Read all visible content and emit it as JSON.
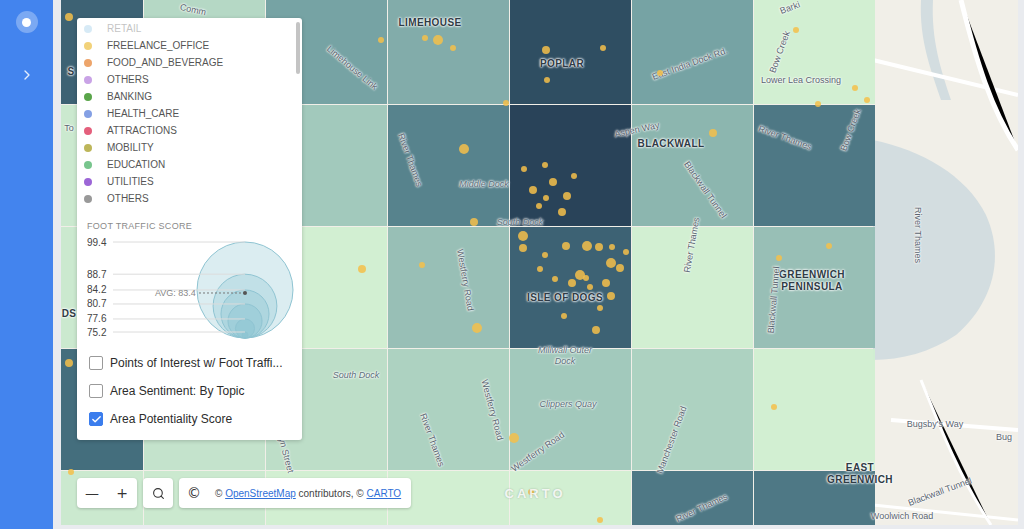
{
  "legend": {
    "categories": [
      {
        "name": "RETAIL",
        "color": "#8ec6e6",
        "faded": true
      },
      {
        "name": "FREELANCE_OFFICE",
        "color": "#f2d27a",
        "faded": false
      },
      {
        "name": "FOOD_AND_BEVERAGE",
        "color": "#eda56b",
        "faded": false
      },
      {
        "name": "OTHERS",
        "color": "#c9a3e6",
        "faded": false
      },
      {
        "name": "BANKING",
        "color": "#5aa54a",
        "faded": false
      },
      {
        "name": "HEALTH_CARE",
        "color": "#84a0e4",
        "faded": false
      },
      {
        "name": "ATTRACTIONS",
        "color": "#e45f7c",
        "faded": false
      },
      {
        "name": "MOBILITY",
        "color": "#bdb65a",
        "faded": false
      },
      {
        "name": "EDUCATION",
        "color": "#78c58d",
        "faded": false
      },
      {
        "name": "UTILITIES",
        "color": "#9c66d6",
        "faded": false
      },
      {
        "name": "OTHERS",
        "color": "#999999",
        "faded": false
      }
    ],
    "foot_traffic": {
      "title": "FOOT TRAFFIC SCORE",
      "ticks": [
        "99.4",
        "88.7",
        "84.2",
        "80.7",
        "77.6",
        "75.2"
      ],
      "avg": "AVG: 83.4"
    },
    "layers": [
      {
        "label": "Points of Interest w/ Foot Traffi...",
        "checked": false
      },
      {
        "label": "Area Sentiment: By Topic",
        "checked": false
      },
      {
        "label": "Area Potentiality Score",
        "checked": true
      }
    ]
  },
  "potentiality_grid": [
    [
      0.85,
      0.25,
      0.55,
      0.5,
      0.95,
      0.55,
      0.05
    ],
    [
      0.1,
      0.15,
      0.35,
      0.7,
      1.0,
      0.45,
      0.75
    ],
    [
      0.1,
      0.15,
      0.05,
      0.4,
      0.85,
      0.05,
      0.4
    ],
    [
      0.8,
      0.15,
      0.2,
      0.3,
      0.35,
      0.3,
      0.05
    ],
    [
      0.1,
      0.1,
      0.05,
      0.05,
      0.05,
      0.75,
      0.75
    ]
  ],
  "map_labels": [
    {
      "text": "LIMEHOUSE",
      "kind": "district"
    },
    {
      "text": "POPLAR",
      "kind": "district"
    },
    {
      "text": "BLACKWALL",
      "kind": "district"
    },
    {
      "text": "ISLE OF DOGS",
      "kind": "district"
    },
    {
      "text": "GREENWICH PENINSULA",
      "kind": "district"
    },
    {
      "text": "EAST GREENWICH",
      "kind": "district"
    },
    {
      "text": "Limehouse Link",
      "kind": "road"
    },
    {
      "text": "East India Dock Rd.",
      "kind": "road"
    },
    {
      "text": "Lower Lea Crossing",
      "kind": "road"
    },
    {
      "text": "Bow Creek",
      "kind": "road"
    },
    {
      "text": "Bow Creek",
      "kind": "road"
    },
    {
      "text": "Barki",
      "kind": "road"
    },
    {
      "text": "Comm",
      "kind": "road"
    },
    {
      "text": "Aspen Way",
      "kind": "road"
    },
    {
      "text": "Middle Dock",
      "kind": "water"
    },
    {
      "text": "South Dock",
      "kind": "water"
    },
    {
      "text": "River Thames",
      "kind": "road"
    },
    {
      "text": "Westferry Road",
      "kind": "road"
    },
    {
      "text": "Millwall Outer Dock",
      "kind": "water"
    },
    {
      "text": "South Dock",
      "kind": "water"
    },
    {
      "text": "Clippers Quay",
      "kind": "water"
    },
    {
      "text": "River Thames",
      "kind": "road"
    },
    {
      "text": "Westferry Road",
      "kind": "road"
    },
    {
      "text": "Westferry Road",
      "kind": "road"
    },
    {
      "text": "Manchester Road",
      "kind": "road"
    },
    {
      "text": "River Thames",
      "kind": "road"
    },
    {
      "text": "Blackwall Tunnel",
      "kind": "road"
    },
    {
      "text": "River Thames",
      "kind": "road"
    },
    {
      "text": "Blackwall Tunnel",
      "kind": "road"
    },
    {
      "text": "River Thames",
      "kind": "road"
    },
    {
      "text": "Bugsby's Way",
      "kind": "road"
    },
    {
      "text": "Bug",
      "kind": "road"
    },
    {
      "text": "Blackwall Tunnel",
      "kind": "road"
    },
    {
      "text": "Woolwich Road",
      "kind": "road"
    },
    {
      "text": "River Thames",
      "kind": "road"
    },
    {
      "text": "elyn Street",
      "kind": "road"
    },
    {
      "text": "DS",
      "kind": "district"
    },
    {
      "text": "S",
      "kind": "district"
    },
    {
      "text": "To",
      "kind": "road"
    }
  ],
  "zoom": {
    "out": "—",
    "in": "+"
  },
  "attribution": {
    "button": "©",
    "parts": [
      {
        "text": "© ",
        "link": false
      },
      {
        "text": "OpenStreetMap",
        "link": true
      },
      {
        "text": " contributors, © ",
        "link": false
      },
      {
        "text": "CARTO",
        "link": true
      }
    ]
  },
  "watermark": "CARTO"
}
